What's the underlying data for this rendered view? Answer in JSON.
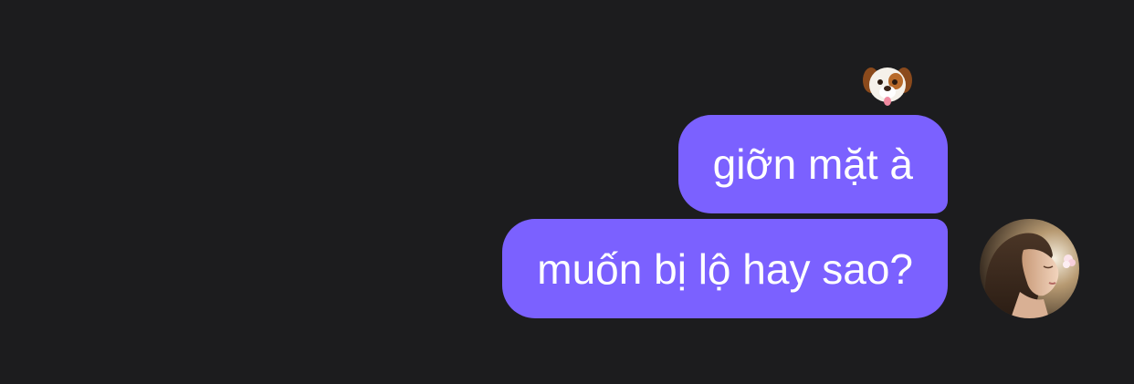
{
  "thread": {
    "reaction": {
      "icon": "dog-face-emoji"
    },
    "messages": [
      {
        "text": "giỡn mặt à"
      },
      {
        "text": "muốn bị lộ hay sao?"
      }
    ],
    "sender_avatar": {
      "icon": "profile-photo-avatar"
    }
  },
  "colors": {
    "background": "#1c1c1e",
    "bubble": "#7b61ff",
    "bubble_text": "#ffffff"
  }
}
